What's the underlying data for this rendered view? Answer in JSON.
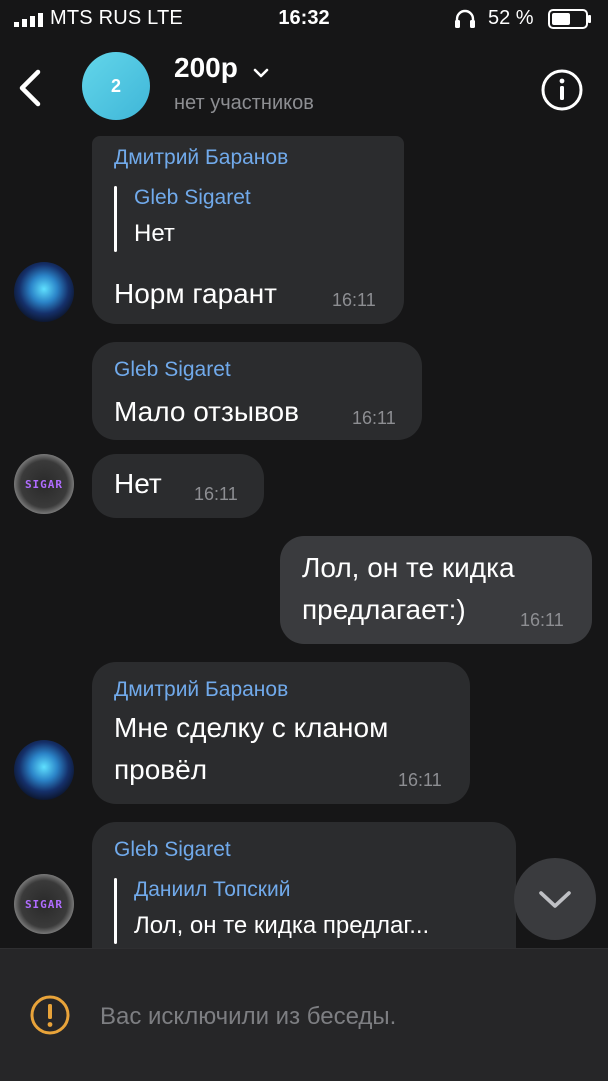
{
  "status_bar": {
    "carrier": "MTS RUS  LTE",
    "time": "16:32",
    "battery": "52 %"
  },
  "header": {
    "avatar_text": "2",
    "title": "200р",
    "subtitle": "нет участников",
    "icons": {
      "back": "back-chevron-icon",
      "dropdown": "chevron-down-icon",
      "info": "info-icon"
    }
  },
  "messages": [
    {
      "sender": "Дмитрий Баранов",
      "quote": {
        "name": "Gleb Sigaret",
        "text": "Нет"
      },
      "text": "Норм гарант",
      "time": "16:11"
    },
    {
      "sender": "Gleb Sigaret",
      "text": "Мало отзывов",
      "time": "16:11"
    },
    {
      "text": "Нет",
      "time": "16:11"
    },
    {
      "outgoing": true,
      "lines": [
        "Лол, он те кидка",
        "предлагает:)"
      ],
      "time": "16:11"
    },
    {
      "sender": "Дмитрий Баранов",
      "lines": [
        "Мне сделку с кланом",
        "провёл"
      ],
      "time": "16:11"
    },
    {
      "sender": "Gleb Sigaret",
      "quote": {
        "name": "Даниил Топский",
        "text": "Лол, он те кидка предлаг..."
      }
    }
  ],
  "avatars": {
    "gleb_text": "SIGAR"
  },
  "bottom": {
    "notice": "Вас исключили из беседы.",
    "icon": "warning-icon"
  },
  "colors": {
    "background": "#161617",
    "bubble_in": "#2b2c2e",
    "bubble_out": "#3a3b3e",
    "accent_name": "#71aaeb",
    "warning": "#e8a33a",
    "avatar_chat": "#52c7e2"
  }
}
